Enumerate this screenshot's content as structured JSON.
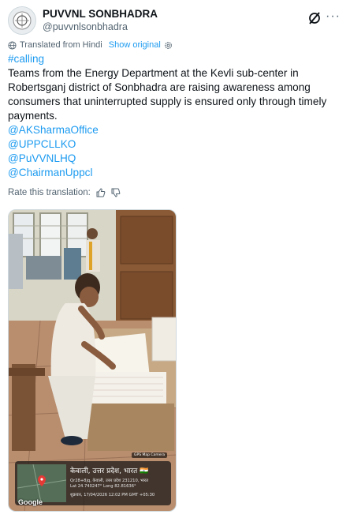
{
  "account": {
    "name": "PUVVNL SONBHADRA",
    "handle": "@puvvnlsonbhadra"
  },
  "translation": {
    "note": "Translated from Hindi",
    "show_original": "Show original"
  },
  "tweet": {
    "hashtag": "#calling",
    "text": "Teams from the Energy Department at the Kevli sub-center in Robertsganj district of Sonbhadra are raising awareness among consumers that uninterrupted supply is ensured only through timely payments.",
    "mentions": [
      "@AKSharmaOffice",
      "@UPPCLLKO",
      "@PuVVNLHQ",
      "@ChairmanUppcl"
    ]
  },
  "rate_translation": "Rate this translation:",
  "photo": {
    "camera_badge": "GPS Map Camera",
    "location_title": "केवाली, उत्तर प्रदेश, भारत 🇮🇳",
    "address": "Qr28+8jq, केवाली, उत्तर प्रदेश 231210, भारत",
    "coords": "Lat 24.740247° Long 82.81636°",
    "datetime": "शुक्रवार, 17/04/2026 12:02 PM GMT +05:30",
    "map_provider": "Google"
  },
  "colors": {
    "link": "#1d9bf0",
    "text": "#0f1419",
    "secondary": "#536471"
  },
  "icons": [
    "avatar-logo",
    "grok-icon",
    "more-icon",
    "translate-icon",
    "settings-icon",
    "thumbs-up-icon",
    "thumbs-down-icon"
  ]
}
